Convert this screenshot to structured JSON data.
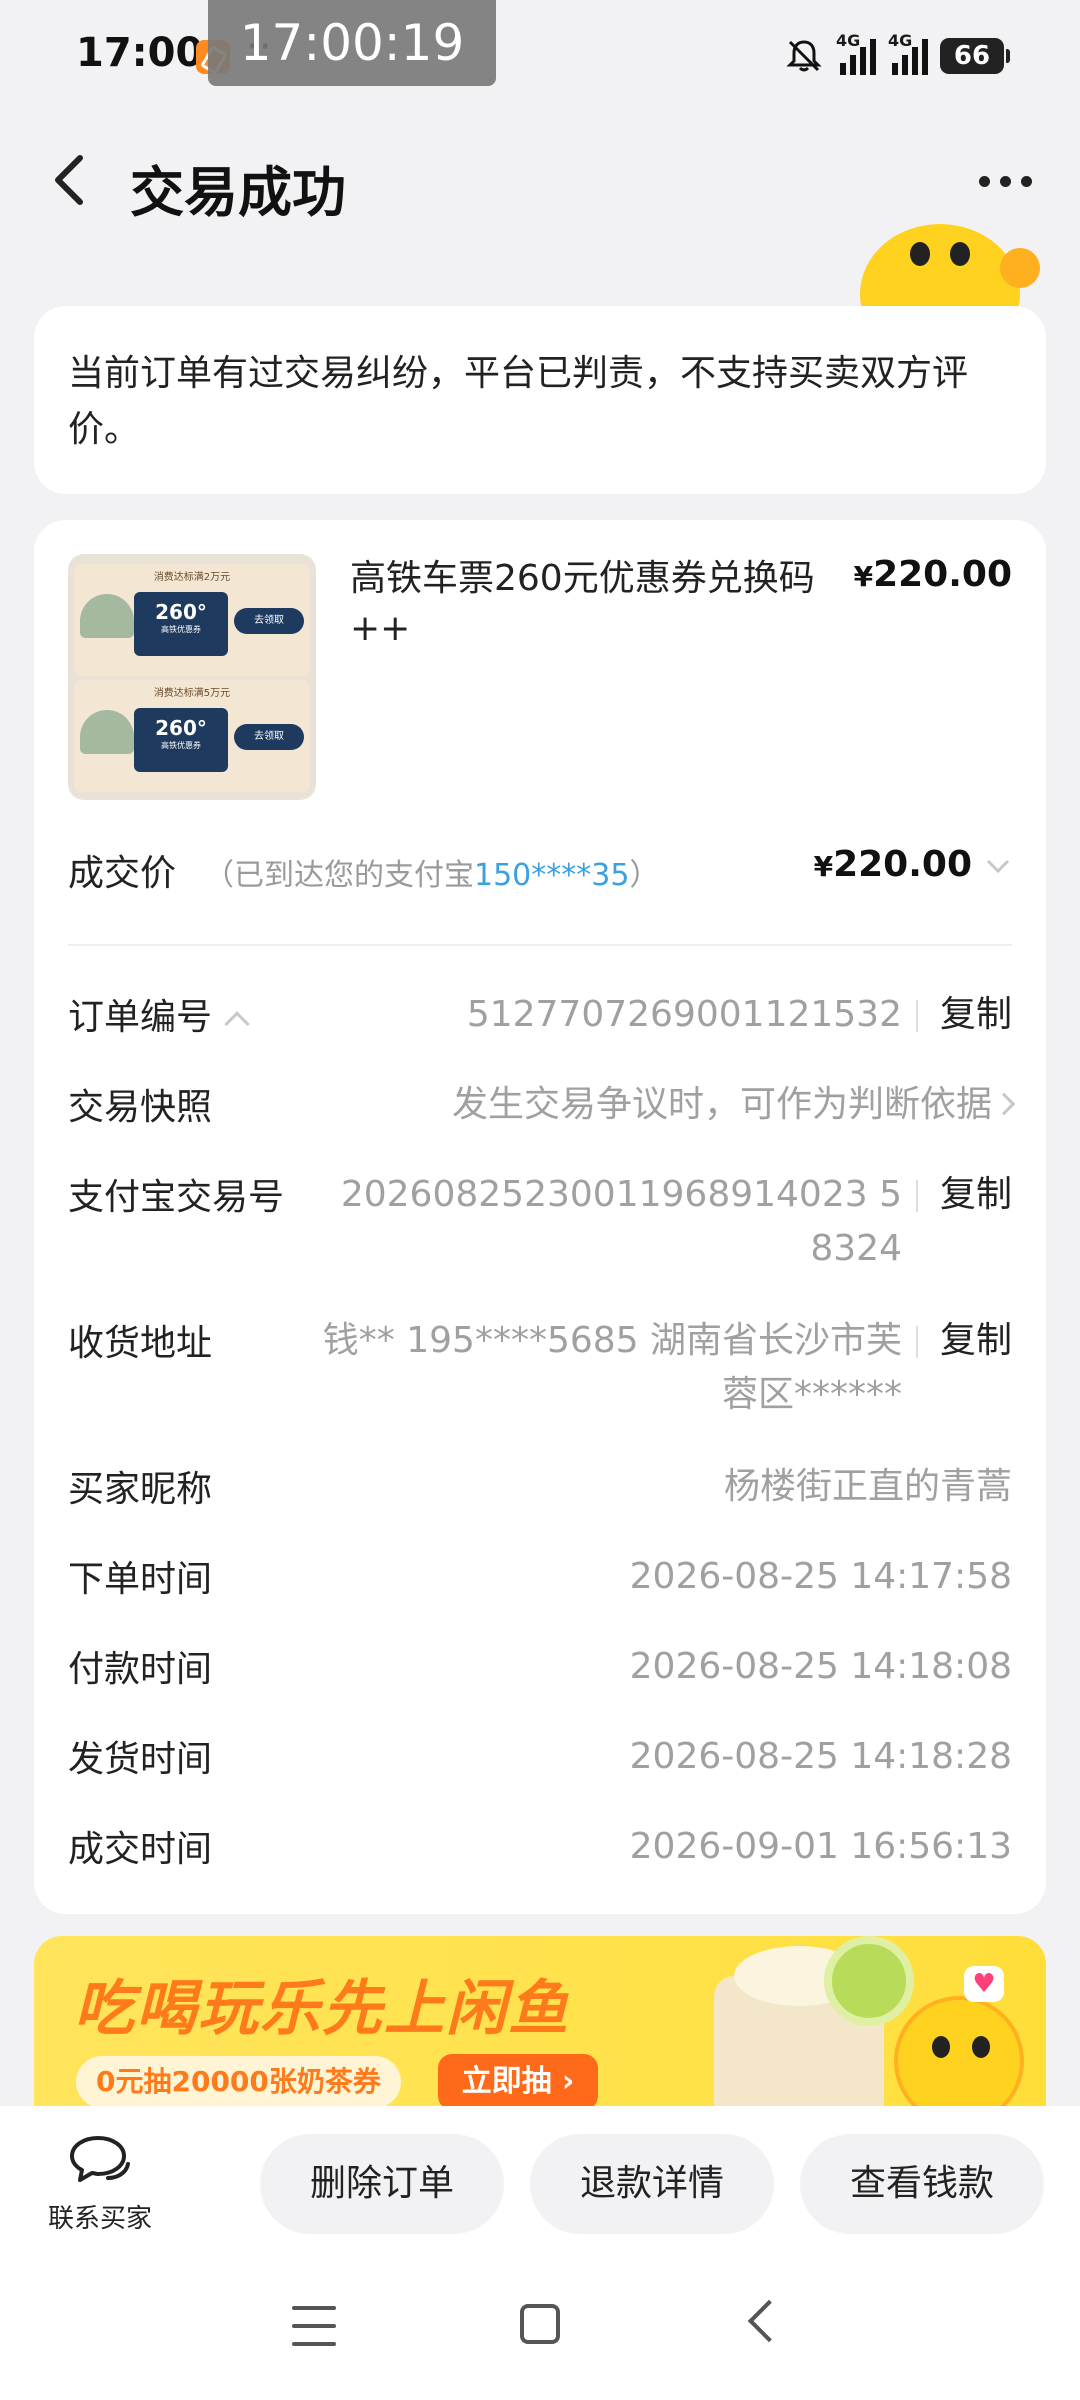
{
  "status_bar": {
    "time": "17:00",
    "dots": "··",
    "overlay_time": "17:00:19",
    "net1": "4G",
    "net2": "4G",
    "battery": "66"
  },
  "header": {
    "title": "交易成功"
  },
  "notice": {
    "text": "当前订单有过交易纠纷，平台已判责，不支持买卖双方评价。"
  },
  "product": {
    "title": "高铁车票260元优惠券兑换码++",
    "price_symbol": "¥",
    "price": "220.00",
    "thumb": {
      "coupon1_caption": "消费达标满2万元",
      "coupon2_caption": "消费达标满5万元",
      "coupon_value": "260°",
      "coupon_sub": "高铁优惠券",
      "coupon_btn": "去领取"
    }
  },
  "deal": {
    "label": "成交价",
    "note_prefix": "（已到达您的支付宝",
    "note_account": "150****35",
    "note_suffix": "）",
    "price_symbol": "¥",
    "price": "220.00"
  },
  "order_info": {
    "order_no_label": "订单编号",
    "order_no": "5127707269001121532",
    "snapshot_label": "交易快照",
    "snapshot_value": "发生交易争议时，可作为判断依据",
    "alipay_no_label": "支付宝交易号",
    "alipay_no_line1": "20260825230011968914023 5",
    "alipay_no_line2": "8324",
    "address_label": "收货地址",
    "address_line1": "钱** 195****5685 湖南省长沙市芙",
    "address_line2": "蓉区******",
    "buyer_label": "买家昵称",
    "buyer_value": "杨楼街正直的青蒿",
    "order_time_label": "下单时间",
    "order_time": "2026-08-25 14:17:58",
    "pay_time_label": "付款时间",
    "pay_time": "2026-08-25 14:18:08",
    "ship_time_label": "发货时间",
    "ship_time": "2026-08-25 14:18:28",
    "deal_time_label": "成交时间",
    "deal_time": "2026-09-01 16:56:13",
    "copy_label": "复制"
  },
  "promo": {
    "title": "吃喝玩乐先上闲鱼",
    "subtitle": "0元抽20000张奶茶券",
    "button": "立即抽 ›"
  },
  "bottom_bar": {
    "contact_label": "联系买家",
    "delete_order": "删除订单",
    "refund_detail": "退款详情",
    "view_money": "查看钱款"
  },
  "colors": {
    "accent_blue": "#3aa0e0",
    "promo_yellow": "#ffe24a",
    "promo_orange": "#ff7a1a"
  },
  "icons": [
    "back-arrow-icon",
    "more-icon",
    "chat-bubble-icon",
    "chevron-up-icon",
    "chevron-right-icon",
    "chevron-down-icon",
    "menu-icon",
    "home-icon",
    "nav-back-icon",
    "mute-icon",
    "signal-icon",
    "battery-icon"
  ]
}
